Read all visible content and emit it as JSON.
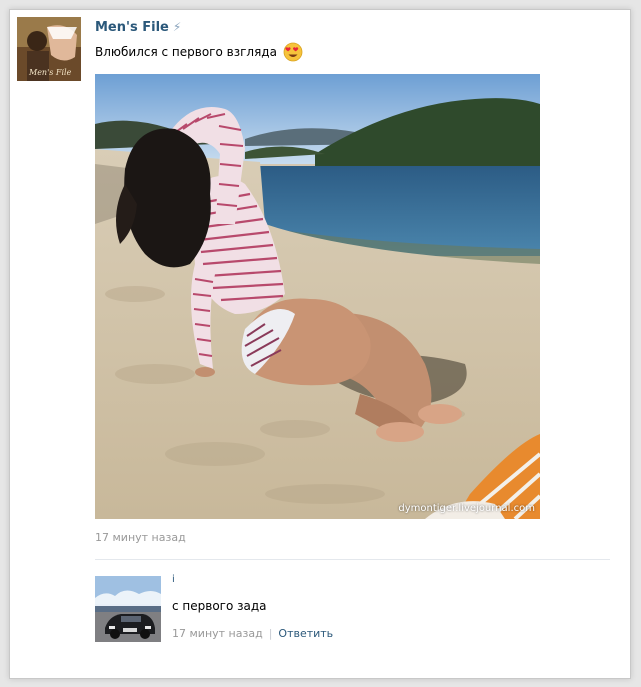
{
  "post": {
    "author": "Men's File",
    "verified_icon": "lightning-bolt-icon",
    "avatar_caption": "Men's File",
    "text": "Влюбился с первого взгляда",
    "emoji": "heart-eyes-emoji-icon",
    "photo_watermark": "dymontiger.livejournal.com",
    "time": "17 минут назад"
  },
  "comment": {
    "author": "i",
    "text": "с первого зада",
    "time": "17 минут назад",
    "separator": "|",
    "reply_label": "Ответить"
  },
  "colors": {
    "link": "#2b587a",
    "muted": "#999999",
    "background": "#ffffff",
    "page": "#e6e6e6"
  }
}
